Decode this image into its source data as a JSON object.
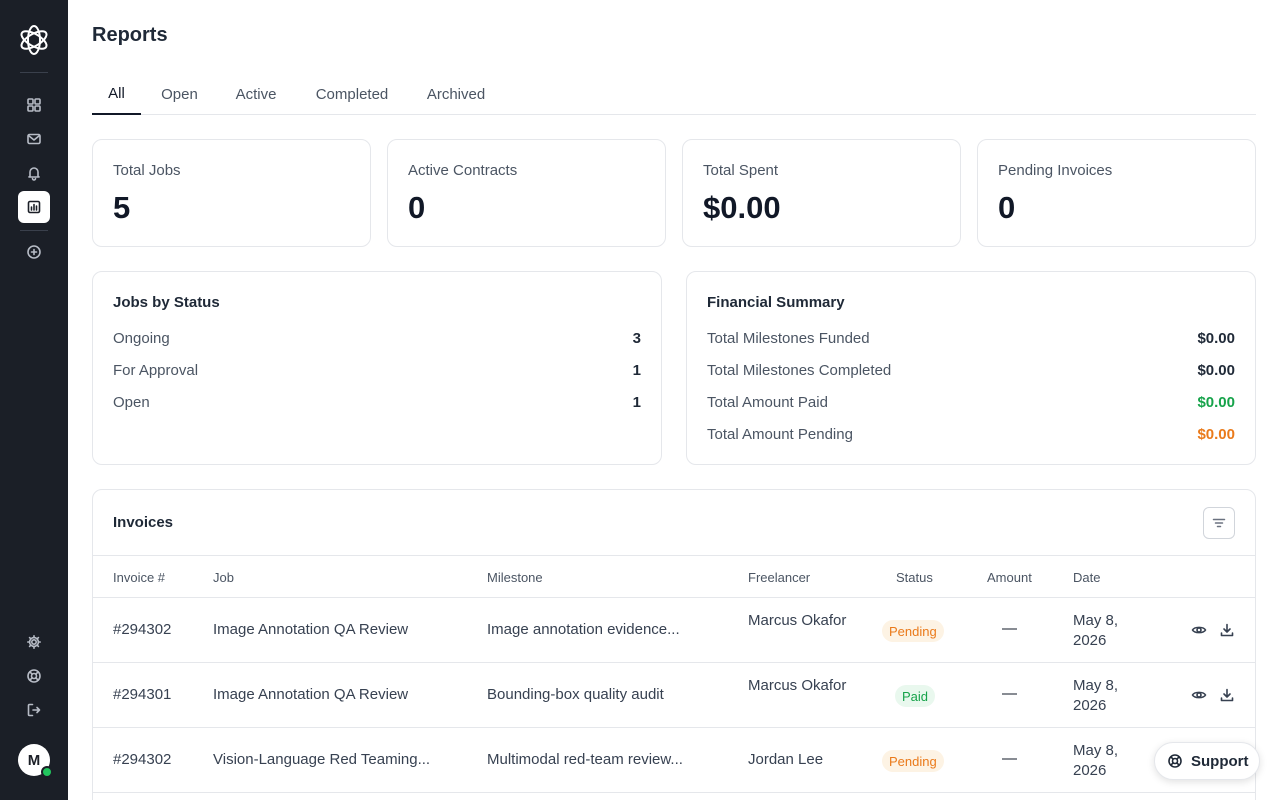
{
  "app": {
    "user_initial": "M"
  },
  "sidebar": {
    "nav": [
      {
        "icon": "grid-icon",
        "active": false
      },
      {
        "icon": "mail-icon",
        "active": false
      },
      {
        "icon": "bell-icon",
        "active": false
      },
      {
        "icon": "chart-icon",
        "active": true
      },
      {
        "icon": "plus-circle-icon",
        "active": false
      }
    ],
    "bottom": [
      {
        "icon": "settings-icon"
      },
      {
        "icon": "help-icon"
      },
      {
        "icon": "logout-icon"
      }
    ]
  },
  "page": {
    "title": "Reports"
  },
  "tabs": [
    "All",
    "Open",
    "Active",
    "Completed",
    "Archived"
  ],
  "active_tab": "All",
  "stats": [
    {
      "label": "Total Jobs",
      "value": "5"
    },
    {
      "label": "Active Contracts",
      "value": "0"
    },
    {
      "label": "Total Spent",
      "value": "$0.00"
    },
    {
      "label": "Pending Invoices",
      "value": "0"
    }
  ],
  "jobs_by_status": {
    "title": "Jobs by Status",
    "rows": [
      {
        "label": "Ongoing",
        "value": "3"
      },
      {
        "label": "For Approval",
        "value": "1"
      },
      {
        "label": "Open",
        "value": "1"
      }
    ]
  },
  "financial_summary": {
    "title": "Financial Summary",
    "rows": [
      {
        "label": "Total Milestones Funded",
        "value": "$0.00",
        "color": "#1f2937"
      },
      {
        "label": "Total Milestones Completed",
        "value": "$0.00",
        "color": "#1f2937"
      },
      {
        "label": "Total Amount Paid",
        "value": "$0.00",
        "color": "#16a34a"
      },
      {
        "label": "Total Amount Pending",
        "value": "$0.00",
        "color": "#ea7a1a"
      }
    ]
  },
  "invoices": {
    "title": "Invoices",
    "columns": [
      "Invoice #",
      "Job",
      "Milestone",
      "Freelancer",
      "Status",
      "Amount",
      "Date"
    ],
    "rows": [
      {
        "invoice": "#294302",
        "job": "Image Annotation QA Review",
        "milestone": "Image annotation evidence...",
        "freelancer": "Marcus Okafor",
        "status": "Pending",
        "amount": "—",
        "date": "May 8, 2026"
      },
      {
        "invoice": "#294301",
        "job": "Image Annotation QA Review",
        "milestone": "Bounding-box quality audit",
        "freelancer": "Marcus Okafor",
        "status": "Paid",
        "amount": "—",
        "date": "May 8, 2026"
      },
      {
        "invoice": "#294302",
        "job": "Vision-Language Red Teaming...",
        "milestone": "Multimodal red-team review...",
        "freelancer": "Jordan Lee",
        "status": "Pending",
        "amount": "—",
        "date": "May 8, 2026"
      }
    ]
  },
  "support": {
    "label": "Support"
  },
  "colors": {
    "sidebar_bg": "#1b1f27",
    "paid": "#16a34a",
    "pending": "#ea7a1a"
  }
}
